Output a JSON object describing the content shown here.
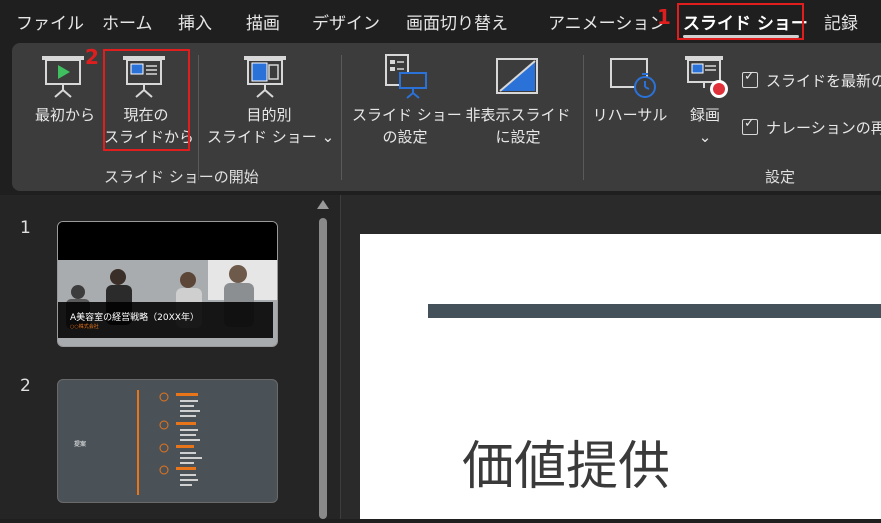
{
  "menu": {
    "tabs": [
      "ファイル",
      "ホーム",
      "挿入",
      "描画",
      "デザイン",
      "画面切り替え",
      "アニメーション",
      "スライド ショー",
      "記録"
    ],
    "active_tab": "スライド ショー"
  },
  "steps": [
    "1",
    "2"
  ],
  "ribbon": {
    "start_group": {
      "label": "スライド ショーの開始",
      "from_beginning": "最初から",
      "from_current_line1": "現在の",
      "from_current_line2": "スライドから",
      "custom_line1": "目的別",
      "custom_line2": "スライド ショー",
      "custom_chevron": "⌄"
    },
    "setup_group": {
      "label": "設定",
      "setup_line1": "スライド ショー",
      "setup_line2": "の設定",
      "hide_line1": "非表示スライド",
      "hide_line2": "に設定",
      "rehearse": "リハーサル",
      "record": "録画",
      "record_chevron": "⌄",
      "check_media": "スライドを最新の",
      "check_narration": "ナレーションの再"
    }
  },
  "slides": [
    {
      "number": "1",
      "title": "A美容室の経営戦略（20XX年）",
      "subtitle": "○○株式会社"
    },
    {
      "number": "2",
      "label": "提案"
    }
  ],
  "canvas": {
    "title": "価値提供"
  },
  "colors": {
    "accent_orange": "#e8751a",
    "step_red": "#e01e1e",
    "icon_blue": "#2a72d8"
  }
}
